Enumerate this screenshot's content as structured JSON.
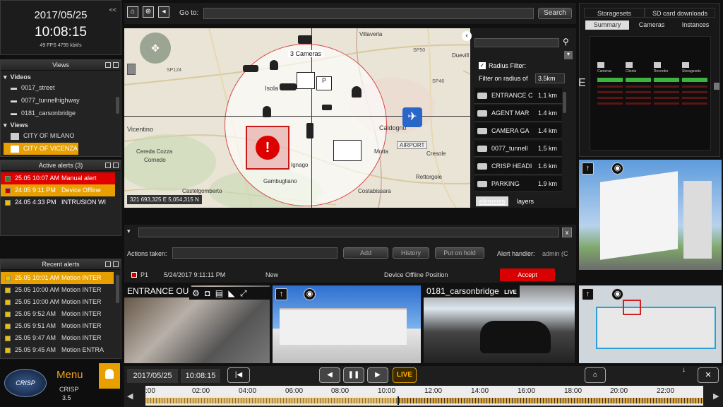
{
  "clock": {
    "date": "2017/05/25",
    "time": "10:08:15",
    "stats": "49 FPS 4795 kbit/s",
    "collapse": "<<"
  },
  "views_panel": {
    "title": "Views",
    "videos_label": "Videos",
    "videos": [
      "0017_street",
      "0077_tunnelhighway",
      "0181_carsonbridge"
    ],
    "views_label": "Views",
    "views": [
      "CITY OF MILANO",
      "CITY OF VICENZA"
    ]
  },
  "active_alerts": {
    "title": "Active alerts (3)",
    "items": [
      {
        "time": "25.05 10:07 AM",
        "label": "Manual alert",
        "color": "#e00000",
        "box": "#2e8b2e"
      },
      {
        "time": "24.05 9:11 PM",
        "label": "Device Offline",
        "color": "#e8a000",
        "box": "#c00000"
      },
      {
        "time": "24.05 4:33 PM",
        "label": "INTRUSION WI",
        "color": "#232323",
        "box": "#e8c000"
      }
    ]
  },
  "recent_alerts": {
    "title": "Recent alerts",
    "items": [
      {
        "time": "25.05 10:01 AM",
        "label": "Motion INTER",
        "hl": true
      },
      {
        "time": "25.05 10:00 AM",
        "label": "Motion INTER",
        "hl": false
      },
      {
        "time": "25.05 10:00 AM",
        "label": "Motion INTER",
        "hl": false
      },
      {
        "time": "25.05 9:52 AM",
        "label": "Motion INTER",
        "hl": false
      },
      {
        "time": "25.05 9:51 AM",
        "label": "Motion INTER",
        "hl": false
      },
      {
        "time": "25.05 9:47 AM",
        "label": "Motion INTER",
        "hl": false
      },
      {
        "time": "25.05 9:45 AM",
        "label": "Motion ENTRA",
        "hl": false
      }
    ]
  },
  "brand": {
    "menu": "Menu",
    "logo": "CRISP",
    "name": "CRISP",
    "version": "3.5"
  },
  "toolbar": {
    "goto_label": "Go to:",
    "search": "Search"
  },
  "map": {
    "labels": [
      {
        "t": "Villaverla"
      },
      {
        "t": "Isola"
      },
      {
        "t": "Vicentino"
      },
      {
        "t": "Caldogno"
      },
      {
        "t": "Cereda Cozza"
      },
      {
        "t": "Cornedo"
      },
      {
        "t": "Ignago"
      },
      {
        "t": "Gambugliano"
      },
      {
        "t": "Motta"
      },
      {
        "t": "Cresole"
      },
      {
        "t": "Rettorgole"
      },
      {
        "t": "Castelgomberto"
      },
      {
        "t": "Costabissara"
      },
      {
        "t": "Duevill"
      }
    ],
    "road_labels": [
      "SP124",
      "SP50",
      "SP46"
    ],
    "cameras_count": "3 Cameras",
    "airport": "AIRPORT",
    "coords": "321 693,325 E   5,054,315 N"
  },
  "filter": {
    "radius_label": "Radius Filter:",
    "filter_on": "Filter on radius of",
    "radius_value": "3.5km",
    "results": [
      {
        "name": "ENTRANCE C",
        "dist": "1.1 km"
      },
      {
        "name": "AGENT MAR",
        "dist": "1.4 km"
      },
      {
        "name": "CAMERA GA",
        "dist": "1.4 km"
      },
      {
        "name": "0077_tunnell",
        "dist": "1.5 km"
      },
      {
        "name": "CRISP HEADI",
        "dist": "1.6 km"
      },
      {
        "name": "PARKING",
        "dist": "1.9 km"
      }
    ],
    "tabs": [
      "elements",
      "layers"
    ]
  },
  "actions": {
    "label": "Actions taken:",
    "add": "Add",
    "history": "History",
    "hold": "Put on hold",
    "handler_label": "Alert handler:",
    "handler": "admin (C",
    "close": "x"
  },
  "alert_row": {
    "priority": "P1",
    "datetime": "5/24/2017 9:11:11 PM",
    "status": "New",
    "desc": "Device Offline Position",
    "accept": "Accept"
  },
  "right_panel": {
    "tabs_top": [
      "Storagesets",
      "SD card downloads"
    ],
    "tabs_sub": [
      "Summary",
      "Cameras",
      "Instances"
    ],
    "side_letter": "E",
    "summary_cols": [
      "Cameras",
      "Clients",
      "Recorder",
      "Storagesets"
    ]
  },
  "cameras": [
    {
      "title": "ENTRANCE OU",
      "live": ""
    },
    {
      "title": "",
      "live": ""
    },
    {
      "title": "0181_carsonbridge",
      "live": "LIVE"
    }
  ],
  "timeline": {
    "date": "2017/05/25",
    "time": "10:08:15",
    "live": "LIVE",
    "ticks": [
      ":00",
      "02:00",
      "04:00",
      "06:00",
      "08:00",
      "10:00",
      "12:00",
      "14:00",
      "16:00",
      "18:00",
      "20:00",
      "22:00"
    ],
    "progress": 0.455
  }
}
